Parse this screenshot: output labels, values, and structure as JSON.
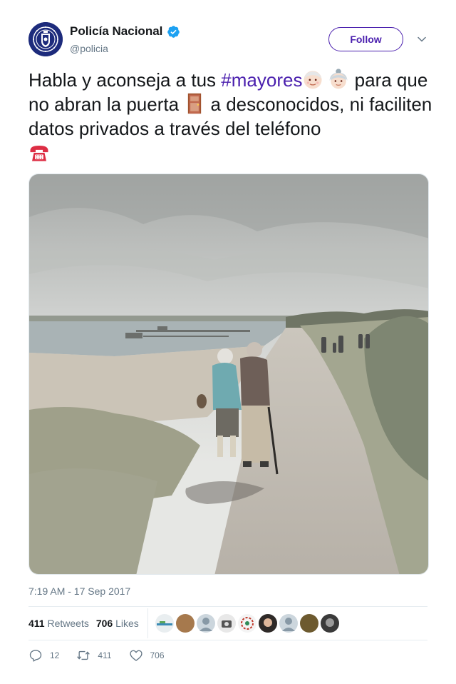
{
  "author": {
    "display_name": "Policía Nacional",
    "handle": "@policia",
    "verified": true,
    "avatar_icon": "police-badge-logo"
  },
  "follow_label": "Follow",
  "tweet": {
    "text_1": "Habla y aconseja a tus ",
    "hashtag": "#mayores",
    "text_2": " para que no abran la puerta ",
    "text_3": " a desconocidos, ni faciliten datos privados a través del teléfono",
    "emojis": [
      "older-man-emoji",
      "older-woman-emoji",
      "door-emoji",
      "telephone-emoji"
    ]
  },
  "media": {
    "alt_icon": "photo-elderly-couple-walking"
  },
  "timestamp": "7:19 AM - 17 Sep 2017",
  "stats": {
    "retweets_count": "411",
    "retweets_label": "Retweets",
    "likes_count": "706",
    "likes_label": "Likes"
  },
  "actions": {
    "reply_count": "12",
    "retweet_count": "411",
    "like_count": "706"
  },
  "colors": {
    "accent": "#4a1fae",
    "verified": "#1da1f2",
    "muted": "#657786"
  }
}
